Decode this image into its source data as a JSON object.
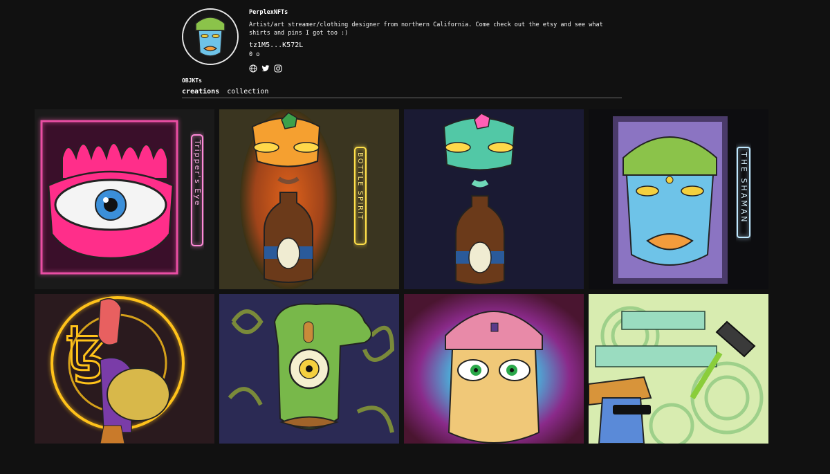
{
  "profile": {
    "username": "PerplexNFTs",
    "bio": "Artist/art streamer/clothing designer from northern California. Come check out the etsy and see what shirts and pins I got too :)",
    "address": "tz1M5...K572L",
    "counts": "0 o"
  },
  "links": [
    {
      "icon": "globe-icon"
    },
    {
      "icon": "twitter-icon"
    },
    {
      "icon": "instagram-icon"
    }
  ],
  "section": {
    "title": "OBJKTs",
    "tabs": [
      "creations",
      "collection"
    ],
    "active_tab": "creations"
  },
  "artworks": [
    {
      "neon_text": "Tripper's Eye",
      "neon_color": "#ff8ad8"
    },
    {
      "neon_text": "BOTTLE SPIRIT",
      "neon_color": "#ffe04a"
    },
    {
      "neon_text": "",
      "neon_color": ""
    },
    {
      "neon_text": "THE SHAMAN",
      "neon_color": "#bfe8ff"
    },
    {
      "neon_text": "",
      "neon_color": "#ffc21a"
    },
    {
      "neon_text": "",
      "neon_color": ""
    },
    {
      "neon_text": "",
      "neon_color": ""
    },
    {
      "neon_text": "",
      "neon_color": ""
    }
  ],
  "colors": {
    "background": "#111111",
    "text": "#ffffff",
    "divider": "#6d6d6d"
  }
}
